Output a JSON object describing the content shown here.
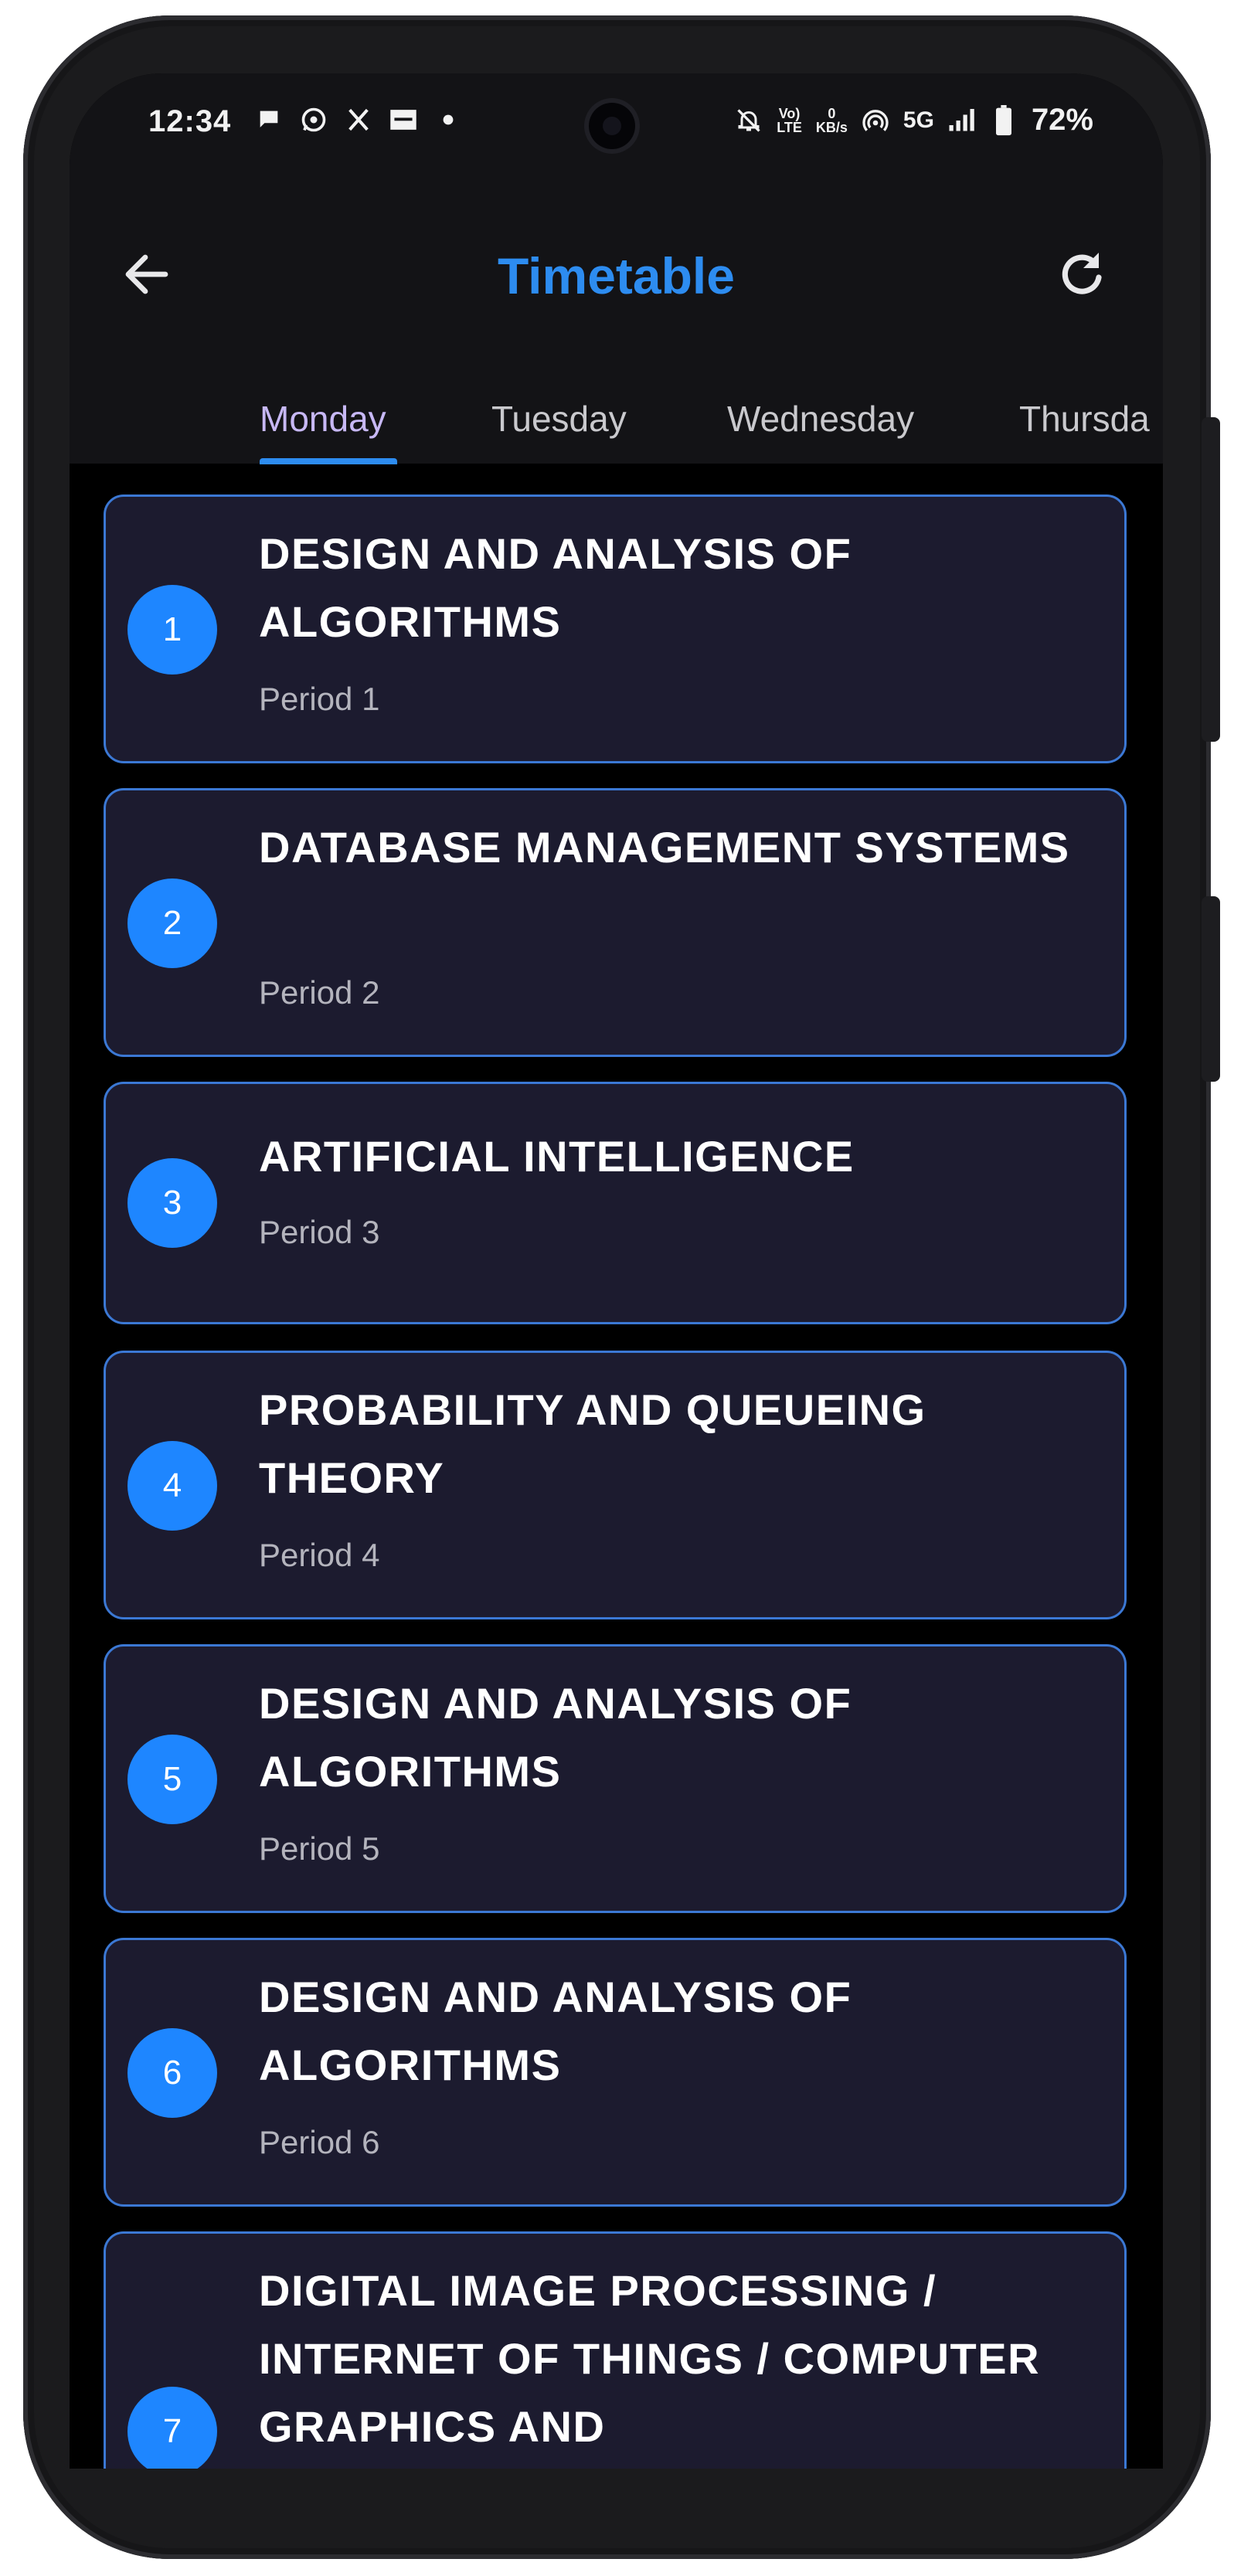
{
  "status_bar": {
    "time": "12:34",
    "left_icons": [
      "chat-bubble-icon",
      "whatsapp-icon",
      "x-icon",
      "news-icon",
      "dot-icon"
    ],
    "right_icons": [
      "bell-off-icon",
      "volte-icon",
      "network-speed-icon",
      "hotspot-icon",
      "5g-icon",
      "signal-icon",
      "battery-icon"
    ],
    "volte_top": "Vo)",
    "volte_bottom": "LTE",
    "speed_top": "0",
    "speed_bottom": "KB/s",
    "network": "5G",
    "battery": "72%"
  },
  "app_bar": {
    "title": "Timetable",
    "back_icon": "arrow-left-icon",
    "refresh_icon": "refresh-icon",
    "title_color": "#2d8cf0"
  },
  "tabs": [
    {
      "label": "Monday",
      "active": true
    },
    {
      "label": "Tuesday",
      "active": false
    },
    {
      "label": "Wednesday",
      "active": false
    },
    {
      "label": "Thursda",
      "active": false
    }
  ],
  "colors": {
    "accent": "#2d8cf0",
    "active_tab": "#c7b8f5",
    "card_bg": "#1c1b2f",
    "card_border": "#3b78d4",
    "badge": "#1e86ff"
  },
  "periods": [
    {
      "number": "1",
      "subject": "DESIGN AND ANALYSIS OF ALGORITHMS",
      "label": "Period 1"
    },
    {
      "number": "2",
      "subject": "DATABASE MANAGEMENT SYSTEMS",
      "label": "Period 2"
    },
    {
      "number": "3",
      "subject": "ARTIFICIAL INTELLIGENCE",
      "label": "Period 3"
    },
    {
      "number": "4",
      "subject": "PROBABILITY AND QUEUEING THEORY",
      "label": "Period 4"
    },
    {
      "number": "5",
      "subject": "DESIGN AND ANALYSIS OF ALGORITHMS",
      "label": "Period 5"
    },
    {
      "number": "6",
      "subject": "DESIGN AND ANALYSIS OF ALGORITHMS",
      "label": "Period 6"
    },
    {
      "number": "7",
      "subject": "DIGITAL IMAGE PROCESSING / INTERNET OF THINGS / COMPUTER GRAPHICS AND",
      "label": ""
    }
  ]
}
